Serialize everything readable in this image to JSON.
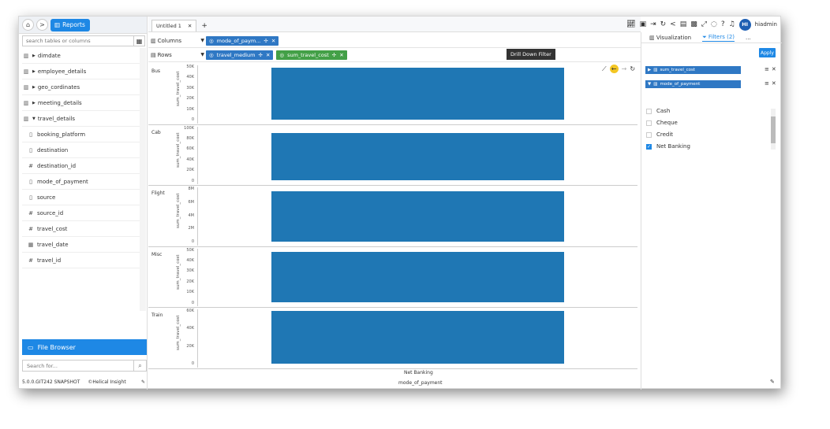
{
  "breadcrumb": {
    "home_icon": "home-icon",
    "separator": ">",
    "reports_label": "Reports"
  },
  "left_panel": {
    "search_placeholder": "search tables or columns",
    "tree": [
      {
        "label": "dimdate",
        "type": "table",
        "expanded": false
      },
      {
        "label": "employee_details",
        "type": "table",
        "expanded": false
      },
      {
        "label": "geo_cordinates",
        "type": "table",
        "expanded": false
      },
      {
        "label": "meeting_details",
        "type": "table",
        "expanded": false
      },
      {
        "label": "travel_details",
        "type": "table",
        "expanded": true
      },
      {
        "label": "booking_platform",
        "type": "text",
        "child": true
      },
      {
        "label": "destination",
        "type": "text",
        "child": true
      },
      {
        "label": "destination_id",
        "type": "number",
        "child": true
      },
      {
        "label": "mode_of_payment",
        "type": "text",
        "child": true
      },
      {
        "label": "source",
        "type": "text",
        "child": true
      },
      {
        "label": "source_id",
        "type": "number",
        "child": true
      },
      {
        "label": "travel_cost",
        "type": "number",
        "child": true
      },
      {
        "label": "travel_date",
        "type": "date",
        "child": true
      },
      {
        "label": "travel_id",
        "type": "number",
        "child": true
      }
    ],
    "file_browser_label": "File Browser",
    "search_for_placeholder": "Search for...",
    "version": "5.0.0.GIT242 SNAPSHOT",
    "brand": "©Helical Insight"
  },
  "tabs": [
    {
      "label": "Untitled 1"
    }
  ],
  "shelves": {
    "columns_label": "Columns",
    "rows_label": "Rows",
    "columns_pills": [
      "mode_of_paym..."
    ],
    "rows_pills": [
      {
        "label": "travel_medium",
        "color": "blue"
      },
      {
        "label": "sum_travel_cost",
        "color": "green"
      }
    ]
  },
  "tooltip": "Drill Down Filter",
  "chart_data": {
    "type": "bar",
    "categories": [
      "Net Banking"
    ],
    "xlabel": "mode_of_payment",
    "ylabel": "sum_travel_cost",
    "panels": [
      {
        "label": "Bus",
        "value": 49000,
        "ylim": [
          0,
          50000
        ],
        "ticks": [
          "50K",
          "40K",
          "30K",
          "20K",
          "10K",
          "0"
        ]
      },
      {
        "label": "Cab",
        "value": 100000,
        "ylim": [
          0,
          110000
        ],
        "ticks": [
          "100K",
          "80K",
          "60K",
          "40K",
          "20K",
          "0"
        ]
      },
      {
        "label": "Flight",
        "value": 7600000,
        "ylim": [
          0,
          8000000
        ],
        "ticks": [
          "8M",
          "6M",
          "4M",
          "2M",
          "0"
        ]
      },
      {
        "label": "Misc",
        "value": 48000,
        "ylim": [
          0,
          50000
        ],
        "ticks": [
          "50K",
          "40K",
          "30K",
          "20K",
          "10K",
          "0"
        ]
      },
      {
        "label": "Train",
        "value": 62000,
        "ylim": [
          0,
          62000
        ],
        "ticks": [
          "60K",
          "40K",
          "20K",
          "0"
        ]
      }
    ],
    "bar_color": "#1f77b4"
  },
  "right_panel": {
    "tabs": [
      {
        "label": "Visualization"
      },
      {
        "label": "Filters (2)"
      },
      {
        "label": "..."
      }
    ],
    "apply_label": "Apply",
    "filters": [
      {
        "label": "sum_travel_cost",
        "expanded": false
      },
      {
        "label": "mode_of_payment",
        "expanded": true,
        "options": [
          {
            "label": "Cash",
            "checked": false
          },
          {
            "label": "Cheque",
            "checked": false
          },
          {
            "label": "Credit",
            "checked": false
          },
          {
            "label": "Net Banking",
            "checked": true
          }
        ]
      }
    ]
  },
  "user": {
    "initials": "HI",
    "name": "hiadmin"
  }
}
